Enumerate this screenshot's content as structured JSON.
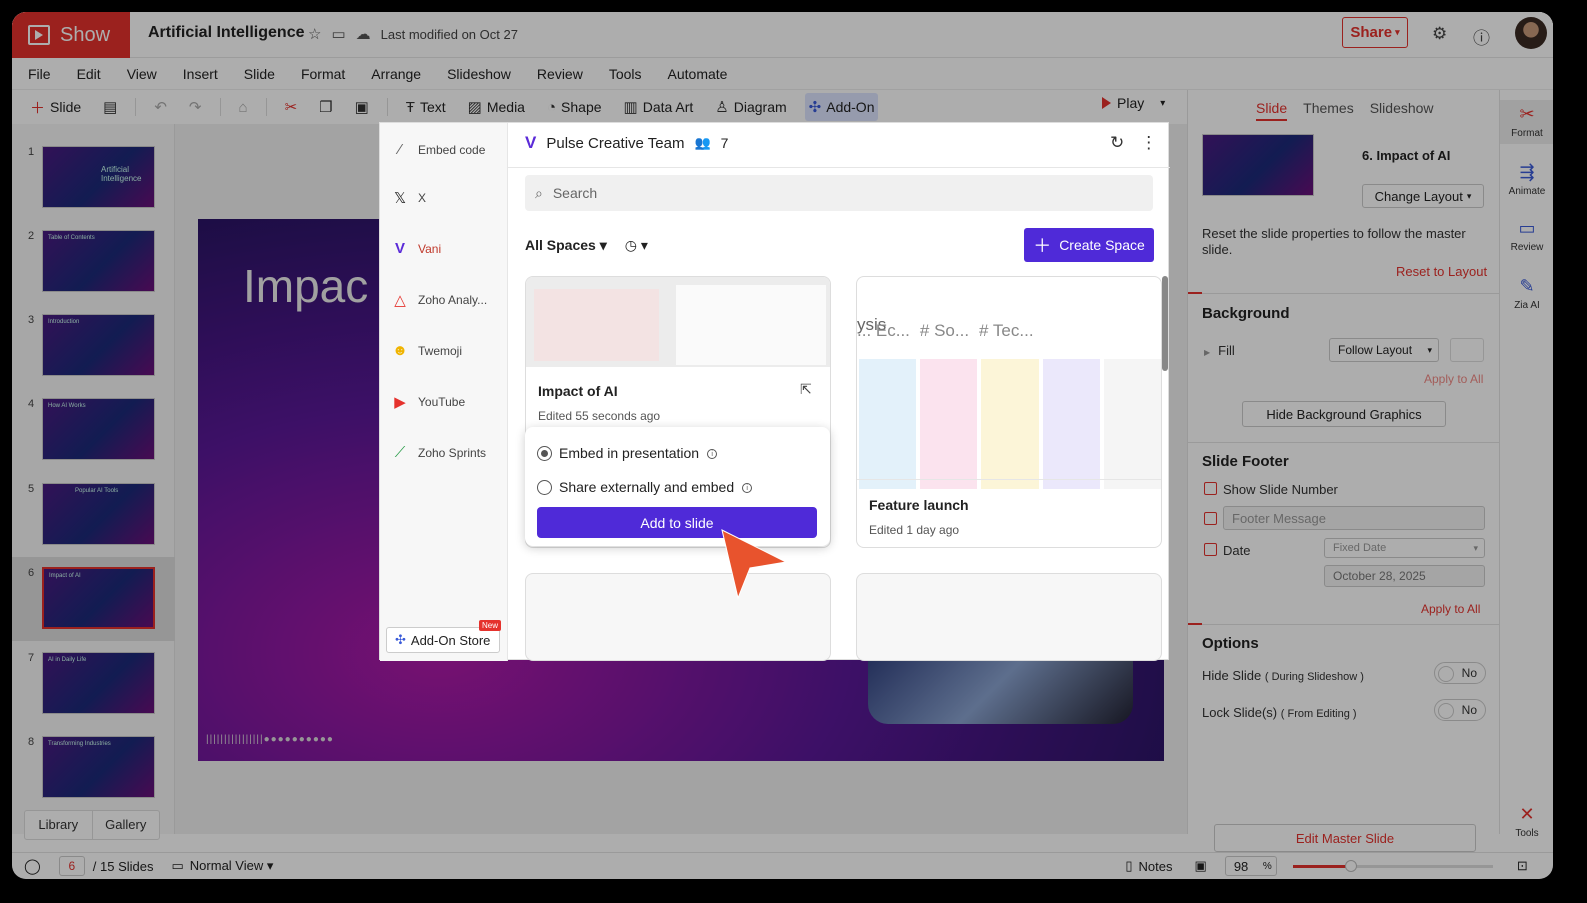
{
  "app": {
    "name": "Show",
    "doc_title": "Artificial Intelligence",
    "last_modified": "Last modified on Oct 27",
    "share": "Share"
  },
  "menu": [
    "File",
    "Edit",
    "View",
    "Insert",
    "Slide",
    "Format",
    "Arrange",
    "Slideshow",
    "Review",
    "Tools",
    "Automate"
  ],
  "toolbar": {
    "slide": "Slide",
    "text": "Text",
    "media": "Media",
    "shape": "Shape",
    "data_art": "Data Art",
    "diagram": "Diagram",
    "addon": "Add-On",
    "play": "Play"
  },
  "thumbnails": [
    {
      "num": "1",
      "label": "Artificial Intelligence"
    },
    {
      "num": "2",
      "label": "Table of Contents"
    },
    {
      "num": "3",
      "label": "Introduction"
    },
    {
      "num": "4",
      "label": "How AI Works"
    },
    {
      "num": "5",
      "label": "Popular AI Tools"
    },
    {
      "num": "6",
      "label": "Impact of AI"
    },
    {
      "num": "7",
      "label": "AI in Daily Life"
    },
    {
      "num": "8",
      "label": "Transforming Industries"
    }
  ],
  "thumb_tabs": {
    "library": "Library",
    "gallery": "Gallery"
  },
  "slide": {
    "title": "Impac"
  },
  "addon_panel": {
    "sidebar": [
      {
        "label": "Embed code",
        "icon": "code-icon"
      },
      {
        "label": "X",
        "icon": "x-icon"
      },
      {
        "label": "Vani",
        "icon": "vani-icon"
      },
      {
        "label": "Zoho Analy...",
        "icon": "analytics-icon"
      },
      {
        "label": "Twemoji",
        "icon": "emoji-icon"
      },
      {
        "label": "YouTube",
        "icon": "youtube-icon"
      },
      {
        "label": "Zoho Sprints",
        "icon": "sprints-icon"
      }
    ],
    "store": "Add-On Store",
    "new_badge": "New",
    "team": "Pulse Creative Team",
    "members": "7",
    "search_placeholder": "Search",
    "all_spaces": "All Spaces",
    "create_space": "Create Space",
    "cards": [
      {
        "title": "Impact of AI",
        "subtitle": "Edited 55 seconds ago"
      },
      {
        "title": "Feature launch",
        "subtitle": "Edited 1 day ago",
        "tags": [
          "ysis",
          "... Ec...",
          "# So...",
          "# Tec..."
        ]
      }
    ],
    "popover": {
      "opt1": "Embed in presentation",
      "opt2": "Share externally and embed",
      "button": "Add to slide"
    }
  },
  "right_panel": {
    "tabs": [
      "Slide",
      "Themes",
      "Slideshow"
    ],
    "slide_name": "6. Impact of AI",
    "change_layout": "Change Layout",
    "reset_text": "Reset the slide properties to follow the master slide.",
    "reset_link": "Reset to Layout",
    "background": "Background",
    "fill": "Fill",
    "fill_value": "Follow Layout",
    "apply_all_1": "Apply to All",
    "hide_bg": "Hide Background Graphics",
    "footer": "Slide Footer",
    "show_num": "Show Slide Number",
    "footer_msg": "Footer Message",
    "date": "Date",
    "fixed_date": "Fixed Date",
    "date_value": "October 28, 2025",
    "apply_all_2": "Apply to All",
    "options": "Options",
    "hide_slide": "Hide Slide",
    "hide_slide_note": "( During Slideshow )",
    "lock_slide": "Lock Slide(s)",
    "lock_note": "( From Editing )",
    "no": "No",
    "edit_master": "Edit Master Slide"
  },
  "far_right": [
    {
      "label": "Format"
    },
    {
      "label": "Animate"
    },
    {
      "label": "Review"
    },
    {
      "label": "Zia AI"
    },
    {
      "label": "Tools"
    }
  ],
  "status": {
    "page": "6",
    "total": "/ 15 Slides",
    "view": "Normal View",
    "notes": "Notes",
    "zoom": "98",
    "pct": "%"
  }
}
